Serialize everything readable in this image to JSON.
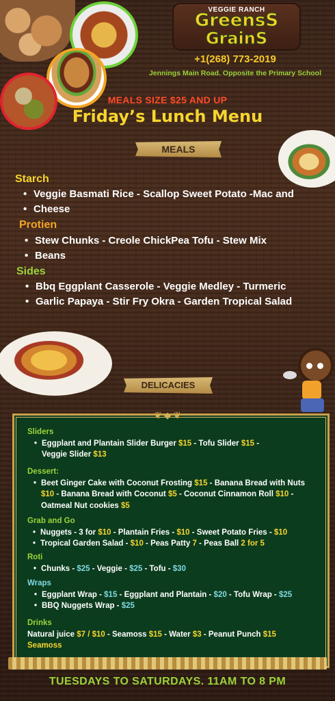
{
  "logo": {
    "top": "VEGGIE RANCH",
    "line1": "GreensS",
    "line2": "GrainS"
  },
  "contact": {
    "phone": "+1(268) 773-2019",
    "address": "Jennings Main Road. Opposite the Primary School"
  },
  "meal_size": "MEALS SIZE $25 AND UP",
  "title": "Friday’s Lunch Menu",
  "meals_banner": "MEALS",
  "meals": {
    "starch": {
      "heading": "Starch",
      "lines": [
        "Veggie Basmati Rice - Scallop Sweet Potato -Mac and",
        "Cheese"
      ]
    },
    "protein": {
      "heading": "Protien",
      "lines": [
        "Stew Chunks - Creole ChickPea Tofu - Stew Mix",
        "Beans"
      ]
    },
    "sides": {
      "heading": "Sides",
      "lines": [
        "Bbq Eggplant Casserole - Veggie Medley - Turmeric",
        "Garlic Papaya - Stir Fry Okra - Garden Tropical Salad"
      ]
    }
  },
  "delicacies_banner": "DELICACIES",
  "delicacies": {
    "sliders": {
      "heading": "Sliders",
      "l1a": "Eggplant and Plantain Slider Burger ",
      "l1b": "$15",
      "l1c": " - Tofu Slider ",
      "l1d": "$15",
      "l1e": " -",
      "l2a": "Veggie Slider ",
      "l2b": "$13"
    },
    "dessert": {
      "heading": "Dessert:",
      "l1a": "Beet Ginger Cake with Coconut Frosting  ",
      "l1b": "$15",
      "l1c": " - Banana Bread with Nuts",
      "l2a": "$10",
      "l2b": " - Banana Bread with Coconut ",
      "l2c": "$5",
      "l2d": " - Coconut Cinnamon Roll ",
      "l2e": "$10",
      "l2f": " -",
      "l3a": "Oatmeal Nut cookies ",
      "l3b": "$5"
    },
    "grab": {
      "heading": "Grab and Go",
      "l1a": "Nuggets - 3 for ",
      "l1b": "$10",
      "l1c": "  - Plantain Fries - ",
      "l1d": "$10",
      "l1e": " - Sweet Potato Fries - ",
      "l1f": "$10",
      "l2a": "Tropical Garden Salad - ",
      "l2b": "$10",
      "l2c": " - Peas Patty ",
      "l2d": "7",
      "l2e": " - Peas Ball ",
      "l2f": "2 for 5"
    },
    "roti": {
      "heading": "Roti",
      "l1a": "Chunks - ",
      "l1b": "$25",
      "l1c": "  -  Veggie - ",
      "l1d": "$25",
      "l1e": "  -  Tofu - ",
      "l1f": "$30"
    },
    "wraps": {
      "heading": "Wraps",
      "l1a": "Eggplant Wrap - ",
      "l1b": "$15",
      "l1c": " - Eggplant and Plantain - ",
      "l1d": "$20",
      "l1e": " - Tofu Wrap - ",
      "l1f": "$25",
      "l2a": "BBQ Nuggets Wrap - ",
      "l2b": "$25"
    },
    "drinks": {
      "heading": "Drinks",
      "l1a": "Natural juice ",
      "l1b": "$7 / $10",
      "l1c": " - Seamoss ",
      "l1d": "$15",
      "l1e": " - Water ",
      "l1f": "$3",
      "l1g": " - Peanut Punch ",
      "l1h": "$15",
      "l2a": "Seamoss"
    }
  },
  "footer": "TUESDAYS TO SATURDAYS. 11AM TO 8 PM"
}
